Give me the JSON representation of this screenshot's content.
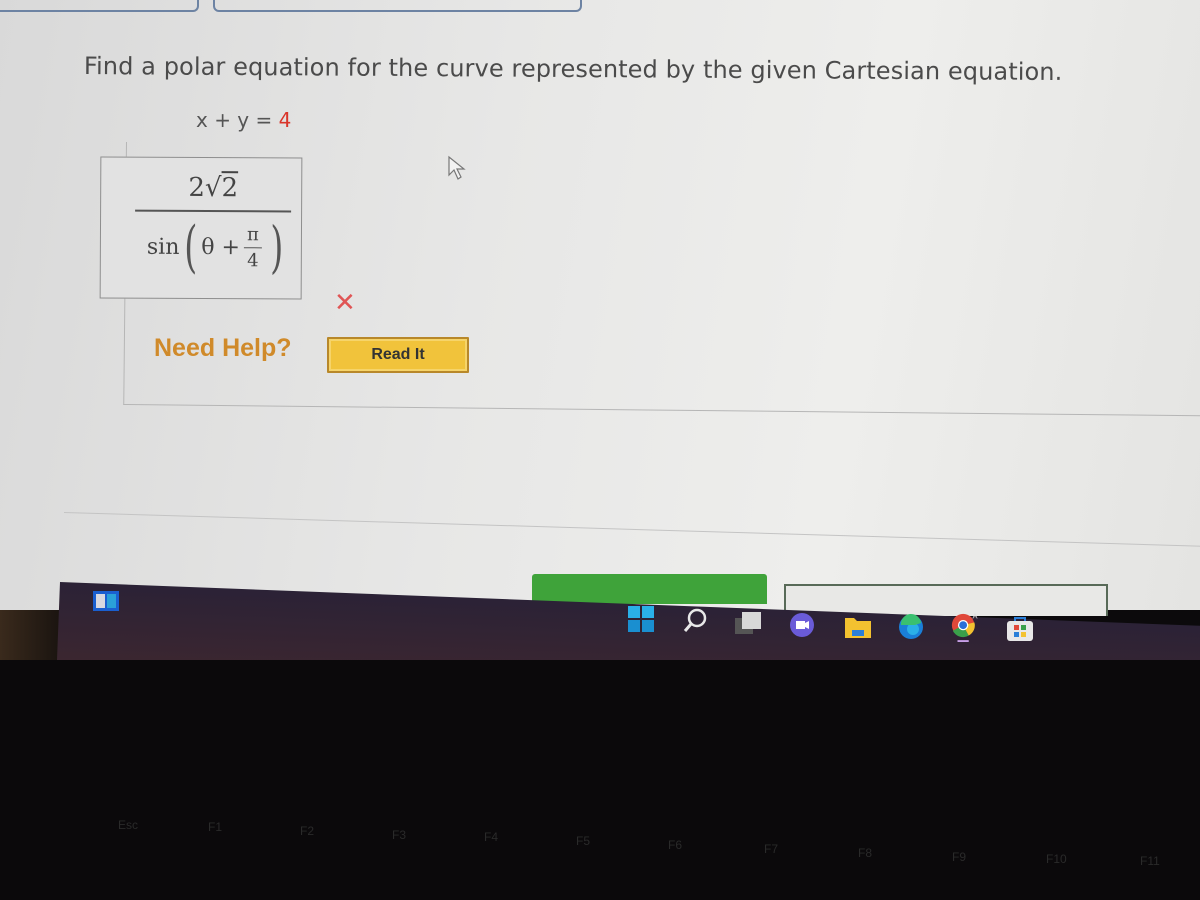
{
  "question": {
    "prompt": "Find a polar equation for the curve represented by the given Cartesian equation.",
    "equation_lhs": "x + y = ",
    "equation_rhs": "4"
  },
  "answer": {
    "numerator_coef": "2",
    "numerator_radicand": "2",
    "denominator_func": "sin",
    "denominator_var": "θ +",
    "denominator_frac_num": "π",
    "denominator_frac_den": "4",
    "status": "incorrect",
    "status_icon": "✕"
  },
  "help": {
    "label": "Need Help?",
    "read_it_label": "Read It"
  },
  "taskbar": {
    "icons": [
      "widgets-icon",
      "start-icon",
      "search-icon",
      "task-view-icon",
      "chat-icon",
      "file-explorer-icon",
      "edge-icon",
      "chrome-icon",
      "store-icon"
    ]
  },
  "keyboard": {
    "keys": [
      "Esc",
      "F1",
      "F2",
      "F3",
      "F4",
      "F5",
      "F6",
      "F7",
      "F8",
      "F9",
      "F10",
      "F11"
    ]
  },
  "colors": {
    "accent_red": "#d9352a",
    "help_orange": "#d08a2a",
    "read_it_yellow": "#f1c33b",
    "submit_green": "#3fa33a"
  }
}
